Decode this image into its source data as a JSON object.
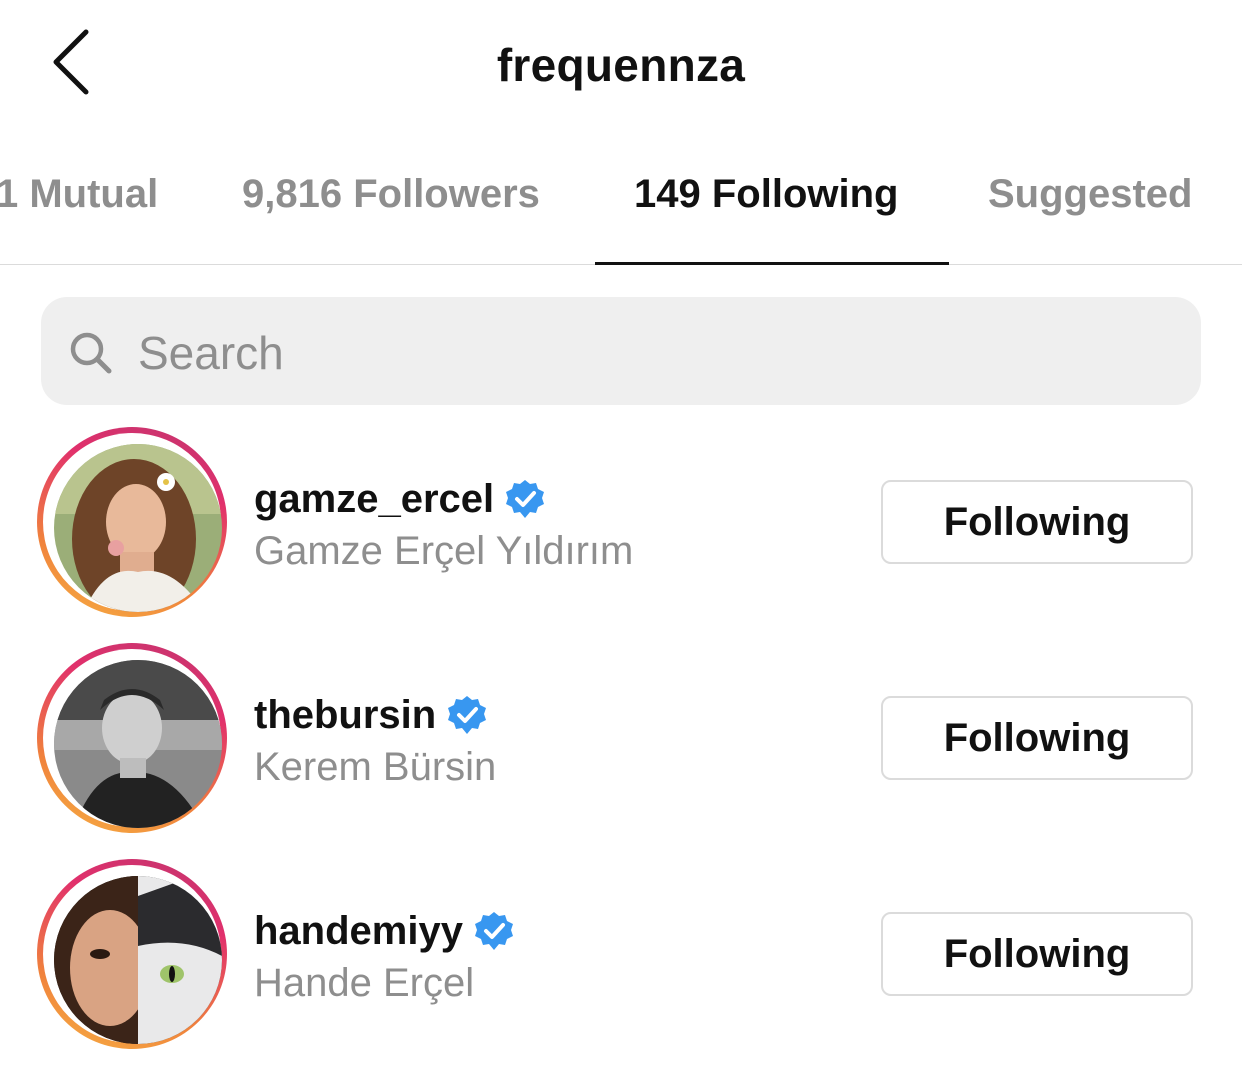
{
  "header": {
    "title": "frequennza",
    "back_icon": "chevron-left-icon"
  },
  "tabs": [
    {
      "label": "1 Mutual",
      "active": false
    },
    {
      "label": "9,816 Followers",
      "active": false
    },
    {
      "label": "149 Following",
      "active": true
    },
    {
      "label": "Suggested",
      "active": false
    }
  ],
  "search": {
    "placeholder": "Search",
    "value": "",
    "icon": "search-icon"
  },
  "accounts": [
    {
      "username": "gamze_ercel",
      "full_name": "Gamze Erçel Yıldırım",
      "verified": true,
      "button_label": "Following"
    },
    {
      "username": "thebursin",
      "full_name": "Kerem Bürsin",
      "verified": true,
      "button_label": "Following"
    },
    {
      "username": "handemiyy",
      "full_name": "Hande Erçel",
      "verified": true,
      "button_label": "Following"
    }
  ],
  "colors": {
    "verified_badge": "#3897f0",
    "story_ring_start": "#f6b042",
    "story_ring_end": "#c1356f",
    "muted_text": "#8e8e8e",
    "primary_text": "#111111"
  }
}
